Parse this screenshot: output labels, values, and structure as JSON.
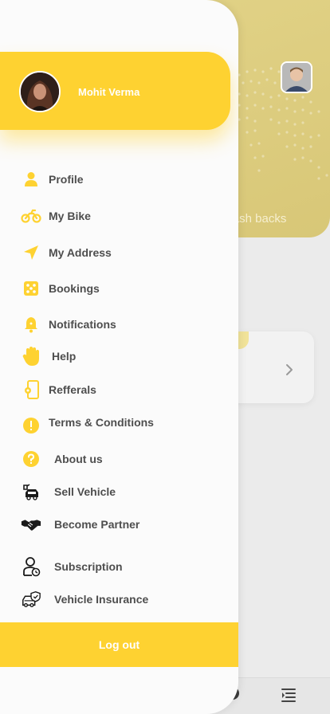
{
  "background": {
    "cashback_text": "Cash backs"
  },
  "drawer": {
    "user_name": "Mohit Verma",
    "menu": [
      {
        "label": "Profile",
        "icon": "person-icon"
      },
      {
        "label": "My Bike",
        "icon": "motorbike-icon"
      },
      {
        "label": "My Address",
        "icon": "navigation-arrow-icon"
      },
      {
        "label": "Bookings",
        "icon": "dice-icon"
      },
      {
        "label": "Notifications",
        "icon": "bell-icon"
      },
      {
        "label": "Help",
        "icon": "hand-icon"
      },
      {
        "label": "Refferals",
        "icon": "phone-gear-icon"
      },
      {
        "label": "Terms & Conditions",
        "icon": "info-circle-icon"
      },
      {
        "label": "About us",
        "icon": "question-circle-icon"
      },
      {
        "label": "Sell Vehicle",
        "icon": "sell-vehicle-icon"
      },
      {
        "label": "Become Partner",
        "icon": "handshake-icon"
      },
      {
        "label": "Subscription",
        "icon": "user-clock-icon"
      },
      {
        "label": "Vehicle Insurance",
        "icon": "car-shield-icon"
      }
    ],
    "logout_label": "Log out"
  },
  "colors": {
    "accent": "#fed231",
    "text": "#4e4e4e",
    "drawer_bg": "#fbfbfb"
  }
}
